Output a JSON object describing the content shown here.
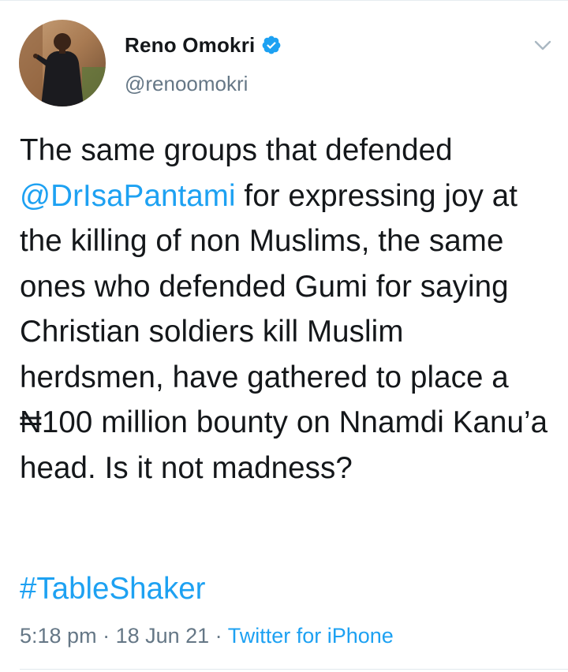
{
  "author": {
    "display_name": "Reno Omokri",
    "handle": "@renoomokri",
    "verified": true
  },
  "tweet": {
    "text_parts": [
      "The same groups that defended ",
      "@DrIsaPantami",
      " for expressing joy at the killing of non Muslims, the same ones who defended Gumi for saying Christian soldiers kill Muslim herdsmen, have gathered to place a ₦100 million bounty on Nnamdi Kanu’a head. Is it not madness?"
    ],
    "hashtag": "#TableShaker"
  },
  "meta": {
    "time": "5:18 pm",
    "separator": " · ",
    "date": "18 Jun 21",
    "source": "Twitter for iPhone"
  },
  "colors": {
    "link": "#1da1f2",
    "secondary_text": "#657786",
    "text": "#14171a"
  },
  "icons": [
    "verified-badge-icon",
    "chevron-down-icon"
  ]
}
